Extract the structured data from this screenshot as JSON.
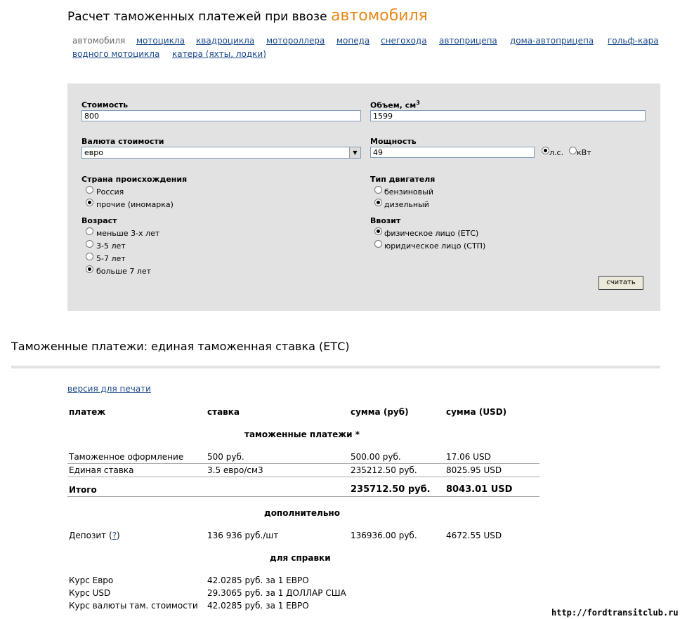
{
  "header": {
    "title_prefix": "Расчет таможенных платежей при ввозе",
    "title_accent": "автомобиля"
  },
  "vehicle_tabs": {
    "active": "автомобиля",
    "links": [
      "мотоцикла",
      "квадроцикла",
      "мотороллера",
      "мопеда",
      "снегохода",
      "автоприцепа",
      "дома-автоприцепа",
      "гольф-кара",
      "водного мотоцикла",
      "катера (яхты, лодки)"
    ]
  },
  "form": {
    "cost": {
      "label": "Стоимость",
      "value": "800"
    },
    "volume": {
      "label": "Объем, см",
      "sup": "3",
      "value": "1599"
    },
    "currency": {
      "label": "Валюта стоимости",
      "value": "евро"
    },
    "power": {
      "label": "Мощность",
      "value": "49",
      "unit_hp": "л.с.",
      "unit_kw": "кВт",
      "selected": "л.с."
    },
    "country": {
      "label": "Страна происхождения",
      "options": [
        "Россия",
        "прочие (иномарка)"
      ],
      "selected": "прочие (иномарка)"
    },
    "engine": {
      "label": "Тип двигателя",
      "options": [
        "бензиновый",
        "дизельный"
      ],
      "selected": "дизельный"
    },
    "age": {
      "label": "Возраст",
      "options": [
        "меньше 3-х лет",
        "3-5 лет",
        "5-7 лет",
        "больше 7 лет"
      ],
      "selected": "больше 7 лет"
    },
    "importer": {
      "label": "Ввозит",
      "options": [
        "физическое лицо (ЕТС)",
        "юридическое лицо (СТП)"
      ],
      "selected": "физическое лицо (ЕТС)"
    },
    "submit_label": "считать"
  },
  "results": {
    "title": "Таможенные платежи: единая таможенная ставка (ЕТС)",
    "print_link": "версия для печати",
    "columns": [
      "платеж",
      "ставка",
      "сумма (руб)",
      "сумма (USD)"
    ],
    "section_customs": "таможенные платежи *",
    "rows": [
      [
        "Таможенное оформление",
        "500 руб.",
        "500.00 руб.",
        "17.06 USD"
      ],
      [
        "Единая ставка",
        "3.5 евро/см3",
        "235212.50 руб.",
        "8025.95 USD"
      ]
    ],
    "total": [
      "Итого",
      "",
      "235712.50 руб.",
      "8043.01 USD"
    ],
    "section_extra": "дополнительно",
    "deposit": {
      "name": "Депозит",
      "help": "?",
      "rate": "136 936 руб./шт",
      "rub": "136936.00 руб.",
      "usd": "4672.55 USD"
    },
    "section_info": "для справки",
    "info": [
      [
        "Курс Евро",
        "42.0285 руб. за 1 ЕВРО"
      ],
      [
        "Курс USD",
        "29.3065 руб. за 1 ДОЛЛАР США"
      ],
      [
        "Курс валюты там. стоимости",
        "42.0285 руб. за 1 ЕВРО"
      ]
    ]
  },
  "watermark": "http://fordtransitclub.ru"
}
